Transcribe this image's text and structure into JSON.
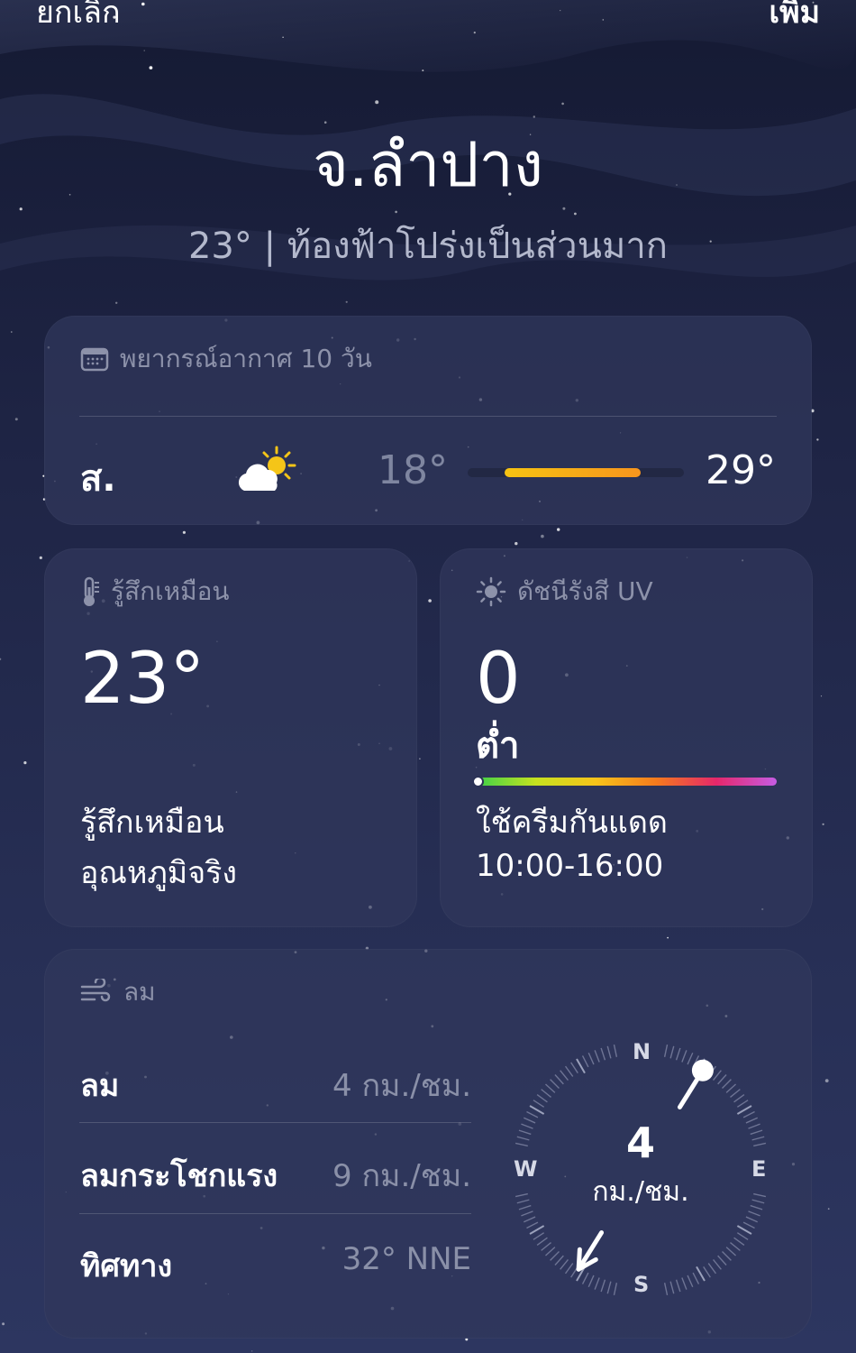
{
  "topbar": {
    "cancel_label": "ยกเลิก",
    "add_label": "เพิ่ม"
  },
  "location": {
    "name": "จ.ลำปาง",
    "summary": "23° | ท้องฟ้าโปร่งเป็นส่วนมาก"
  },
  "forecast": {
    "header": "พยากรณ์อากาศ 10 วัน",
    "days": [
      {
        "day": "ส.",
        "icon": "partly-cloudy-sun-icon",
        "low": "18°",
        "high": "29°",
        "range_start": 0.17,
        "range_end": 0.8
      }
    ]
  },
  "feels_like": {
    "header": "รู้สึกเหมือน",
    "value": "23°",
    "description_line1": "รู้สึกเหมือน",
    "description_line2": "อุณหภูมิจริง"
  },
  "uv": {
    "header": "ดัชนีรังสี UV",
    "value": "0",
    "level": "ต่ำ",
    "level_fraction": 0.0,
    "advice_line1": "ใช้ครีมกันแดด",
    "advice_line2": "10:00-16:00"
  },
  "wind": {
    "header": "ลม",
    "rows": [
      {
        "label": "ลม",
        "value": "4 กม./ชม."
      },
      {
        "label": "ลมกระโชกแรง",
        "value": "9 กม./ชม."
      },
      {
        "label": "ทิศทาง",
        "value": "32° NNE"
      }
    ],
    "compass": {
      "speed": "4",
      "unit": "กม./ชม.",
      "direction_deg": 32,
      "n": "N",
      "e": "E",
      "s": "S",
      "w": "W"
    }
  },
  "colors": {
    "temp_bar_start": "#f6c312",
    "temp_bar_end": "#f7951d",
    "uv_gradient": [
      "#3bd14a",
      "#c6e21f",
      "#f7c31a",
      "#f57a1d",
      "#e5276b",
      "#c65ce3"
    ]
  }
}
